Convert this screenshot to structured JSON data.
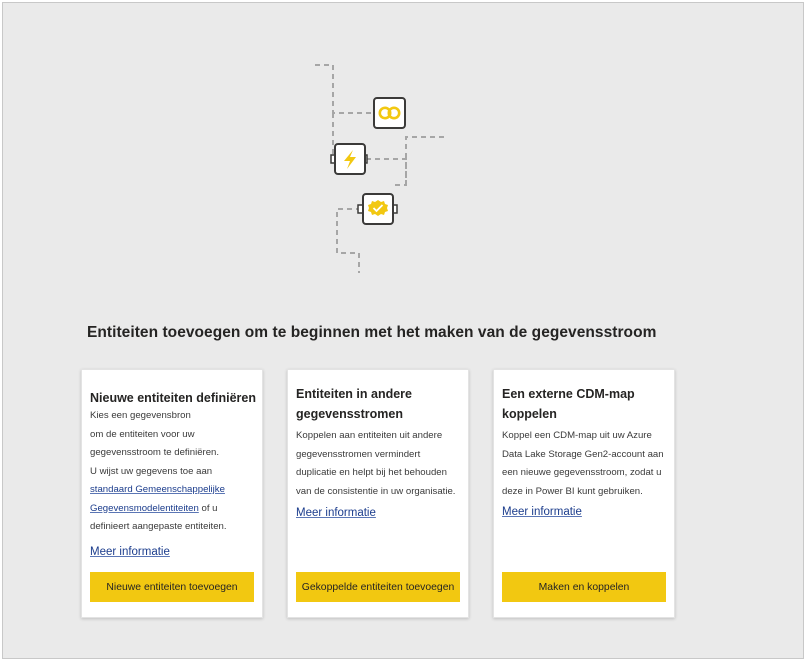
{
  "heading": "Entiteiten toevoegen om te beginnen met het maken van de gegevensstroom",
  "cards": [
    {
      "title": [
        "Nieuwe entiteiten definiëren"
      ],
      "body": {
        "line1": "Kies een gegevensbron",
        "line2": "om de entiteiten voor uw",
        "line3": "gegevensstroom te definiëren.",
        "line4": "U wijst uw gegevens toe aan",
        "link_line1": "standaard Gemeenschappelijke",
        "link_line2": "Gegevensmodelentiteiten",
        "after_link": " of u",
        "line7": "definieert aangepaste entiteiten."
      },
      "more_link": "Meer informatie",
      "button": "Nieuwe entiteiten toevoegen"
    },
    {
      "title": [
        "Entiteiten in andere",
        "gegevensstromen"
      ],
      "body": {
        "line1": "Koppelen aan entiteiten uit andere",
        "line2": "gegevensstromen vermindert",
        "line3": "duplicatie en helpt bij het behouden",
        "line4": "van de consistentie in uw organisatie."
      },
      "more_link": "Meer informatie",
      "button": "Gekoppelde entiteiten toevoegen"
    },
    {
      "title": [
        "Een externe CDM-map",
        "koppelen"
      ],
      "body": {
        "line1": "Koppel een CDM-map uit uw Azure",
        "line2": "Data Lake Storage Gen2-account aan",
        "line3": "een nieuwe gegevensstroom, zodat u",
        "line4": "deze in Power BI kunt gebruiken."
      },
      "more_link": "Meer informatie",
      "button": "Maken en koppelen"
    }
  ],
  "colors": {
    "accent": "#f2c811",
    "link": "#1b3c8c",
    "background": "#eaeaea",
    "card": "#ffffff"
  },
  "illustration_icons": [
    "link-icon",
    "lightning-icon",
    "checkmark-badge-icon"
  ]
}
